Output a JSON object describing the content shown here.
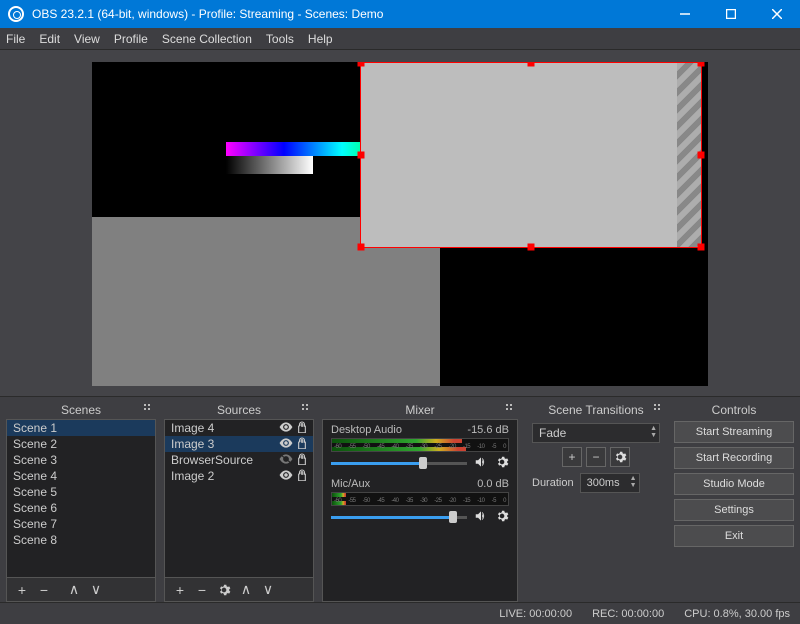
{
  "title": "OBS 23.2.1 (64-bit, windows) - Profile: Streaming - Scenes: Demo",
  "menubar": [
    "File",
    "Edit",
    "View",
    "Profile",
    "Scene Collection",
    "Tools",
    "Help"
  ],
  "panels": {
    "scenes": {
      "title": "Scenes",
      "items": [
        "Scene 1",
        "Scene 2",
        "Scene 3",
        "Scene 4",
        "Scene 5",
        "Scene 6",
        "Scene 7",
        "Scene 8"
      ],
      "selected": 0
    },
    "sources": {
      "title": "Sources",
      "items": [
        {
          "name": "Image 4",
          "visible": true,
          "locked": false
        },
        {
          "name": "Image 3",
          "visible": true,
          "locked": false,
          "selected": true
        },
        {
          "name": "BrowserSource",
          "visible": false,
          "locked": false
        },
        {
          "name": "Image 2",
          "visible": true,
          "locked": false
        }
      ]
    },
    "mixer": {
      "title": "Mixer",
      "channels": [
        {
          "label": "Desktop Audio",
          "db": "-15.6 dB"
        },
        {
          "label": "Mic/Aux",
          "db": "0.0 dB"
        }
      ],
      "ticks": [
        "-60",
        "-55",
        "-50",
        "-45",
        "-40",
        "-35",
        "-30",
        "-25",
        "-20",
        "-15",
        "-10",
        "-5",
        "0"
      ]
    },
    "transitions": {
      "title": "Scene Transitions",
      "type": "Fade",
      "duration_label": "Duration",
      "duration_value": "300ms"
    },
    "controls": {
      "title": "Controls",
      "buttons": [
        "Start Streaming",
        "Start Recording",
        "Studio Mode",
        "Settings",
        "Exit"
      ]
    }
  },
  "status": {
    "live": "LIVE: 00:00:00",
    "rec": "REC: 00:00:00",
    "cpu": "CPU: 0.8%, 30.00 fps"
  }
}
